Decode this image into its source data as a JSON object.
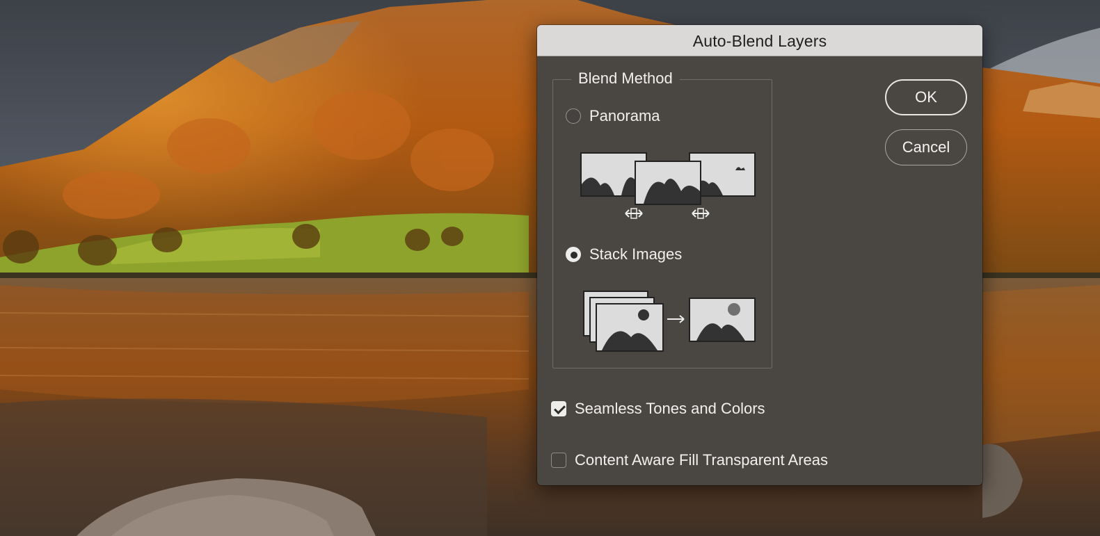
{
  "dialog": {
    "title": "Auto-Blend Layers",
    "blend_method": {
      "legend": "Blend Method",
      "options": [
        {
          "label": "Panorama",
          "selected": false
        },
        {
          "label": "Stack Images",
          "selected": true
        }
      ]
    },
    "checkboxes": [
      {
        "label": "Seamless Tones and Colors",
        "checked": true
      },
      {
        "label": "Content Aware Fill Transparent Areas",
        "checked": false
      }
    ],
    "buttons": {
      "ok": "OK",
      "cancel": "Cancel"
    }
  },
  "icons": {
    "panorama": "panorama-illustration-icon",
    "stack": "stack-images-illustration-icon"
  },
  "colors": {
    "dialog_bg": "#4a4743",
    "titlebar_bg": "#dbd9d8",
    "text": "#f1f0ee"
  }
}
